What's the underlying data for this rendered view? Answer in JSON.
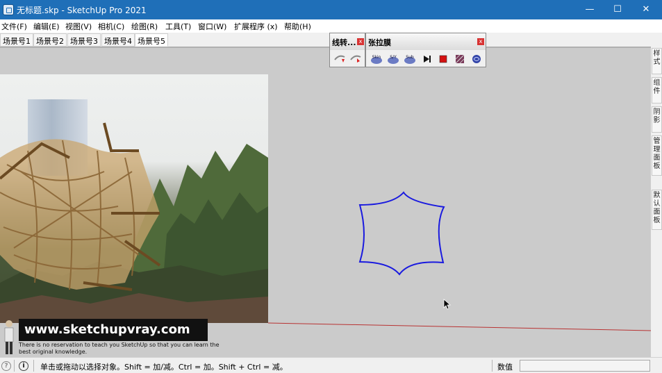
{
  "window": {
    "title": "无标题.skp - SketchUp Pro 2021",
    "controls": {
      "minimize": "—",
      "maximize": "☐",
      "close": "✕"
    }
  },
  "menu": [
    "文件(F)",
    "编辑(E)",
    "视图(V)",
    "相机(C)",
    "绘图(R)",
    "工具(T)",
    "窗口(W)",
    "扩展程序 (x)",
    "帮助(H)"
  ],
  "scene_tabs": [
    "场景号1",
    "场景号2",
    "场景号3",
    "场景号4",
    "场景号5"
  ],
  "active_tab_index": 4,
  "toolbars": {
    "line_turn": {
      "title": "线转...",
      "close": "x",
      "buttons": [
        "line-to-curve-up-icon",
        "line-to-curve-right-icon"
      ]
    },
    "tension": {
      "title": "张拉膜",
      "close": "x",
      "buttons": [
        {
          "label": "Skin",
          "icon": "skin-icon"
        },
        {
          "label": "S/Y",
          "icon": "sy-icon"
        },
        {
          "label": "Sub",
          "icon": "sub-icon"
        },
        {
          "label": "",
          "icon": "play-icon"
        },
        {
          "label": "",
          "icon": "stop-icon"
        },
        {
          "label": "",
          "icon": "pattern-icon"
        },
        {
          "label": "",
          "icon": "sphere-icon"
        }
      ]
    }
  },
  "watermark": {
    "site": "www.sketchupvray.com",
    "caption": "There is no reservation to teach you SketchUp so that you can learn the best original knowledge."
  },
  "side_panels": [
    "样式",
    "组件",
    "阴影",
    "管理面板",
    "默认面板"
  ],
  "status_bar": {
    "hint": "单击或拖动以选择对象。Shift = 加/减。Ctrl = 加。Shift + Ctrl = 减。",
    "value_label": "数值",
    "value": ""
  },
  "colors": {
    "titlebar": "#1f6fb8",
    "curve": "#1a1adf",
    "axis_red": "#b83232",
    "viewport": "#cbcbcb"
  }
}
